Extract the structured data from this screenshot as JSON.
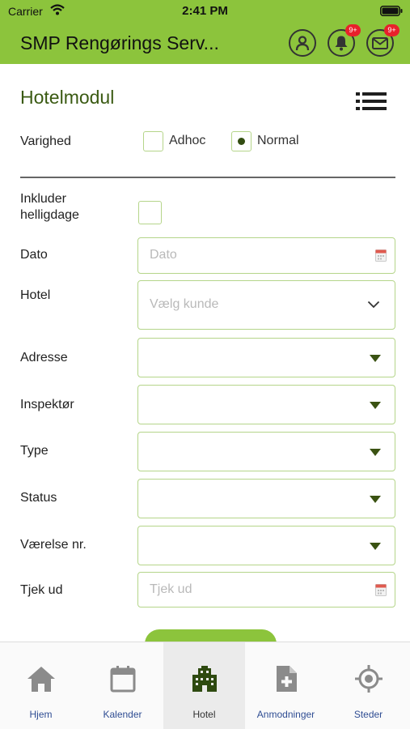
{
  "status_bar": {
    "carrier": "Carrier",
    "time": "2:41 PM"
  },
  "header": {
    "title": "SMP Rengørings Serv...",
    "notifications_badge": "9+",
    "messages_badge": "9+"
  },
  "page": {
    "title": "Hotelmodul",
    "menu_icon": "list-icon"
  },
  "varighed": {
    "label": "Varighed",
    "options": [
      {
        "label": "Adhoc",
        "selected": false
      },
      {
        "label": "Normal",
        "selected": true
      }
    ]
  },
  "form": {
    "holidays_label": "Inkluder helligdage",
    "dato_label": "Dato",
    "dato_placeholder": "Dato",
    "hotel_label": "Hotel",
    "hotel_placeholder": "Vælg kunde",
    "adresse_label": "Adresse",
    "inspektor_label": "Inspektør",
    "type_label": "Type",
    "status_label": "Status",
    "vaerelse_label": "Værelse nr.",
    "tjek_label": "Tjek ud",
    "tjek_placeholder": "Tjek ud"
  },
  "tabs": [
    {
      "label": "Hjem",
      "icon": "home-icon",
      "active": false
    },
    {
      "label": "Kalender",
      "icon": "calendar-icon",
      "active": false
    },
    {
      "label": "Hotel",
      "icon": "building-icon",
      "active": true
    },
    {
      "label": "Anmodninger",
      "icon": "file-plus-icon",
      "active": false
    },
    {
      "label": "Steder",
      "icon": "location-target-icon",
      "active": false
    }
  ],
  "colors": {
    "brand_green": "#8cc43c",
    "field_border": "#b5d58a",
    "dark_green": "#3a5212",
    "tab_label": "#2f4d93",
    "badge": "#e8212b"
  }
}
